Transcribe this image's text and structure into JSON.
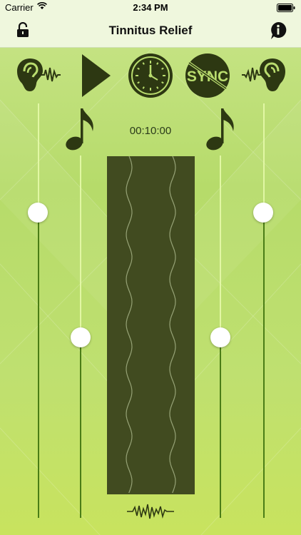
{
  "status_bar": {
    "carrier": "Carrier",
    "time": "2:34 PM",
    "wifi_icon": "wifi-icon",
    "battery_icon": "battery-icon"
  },
  "nav": {
    "title": "Tinnitus Relief",
    "left_icon": "lock-icon",
    "right_icon": "info-icon"
  },
  "controls": {
    "left_ear_icon": "ear-left-icon",
    "right_ear_icon": "ear-right-icon",
    "play_icon": "play-icon",
    "timer_icon": "clock-icon",
    "sync_label": "SYNC",
    "sync_icon": "sync-disabled-icon"
  },
  "timer": {
    "value": "00:10:00"
  },
  "sliders": {
    "left_volume": 0.81,
    "left_tone": 0.5,
    "right_tone": 0.5,
    "right_volume": 0.81
  },
  "theme": {
    "accent": "#4a7d16",
    "icon_color": "#2d3812",
    "panel_color": "#414b20"
  }
}
